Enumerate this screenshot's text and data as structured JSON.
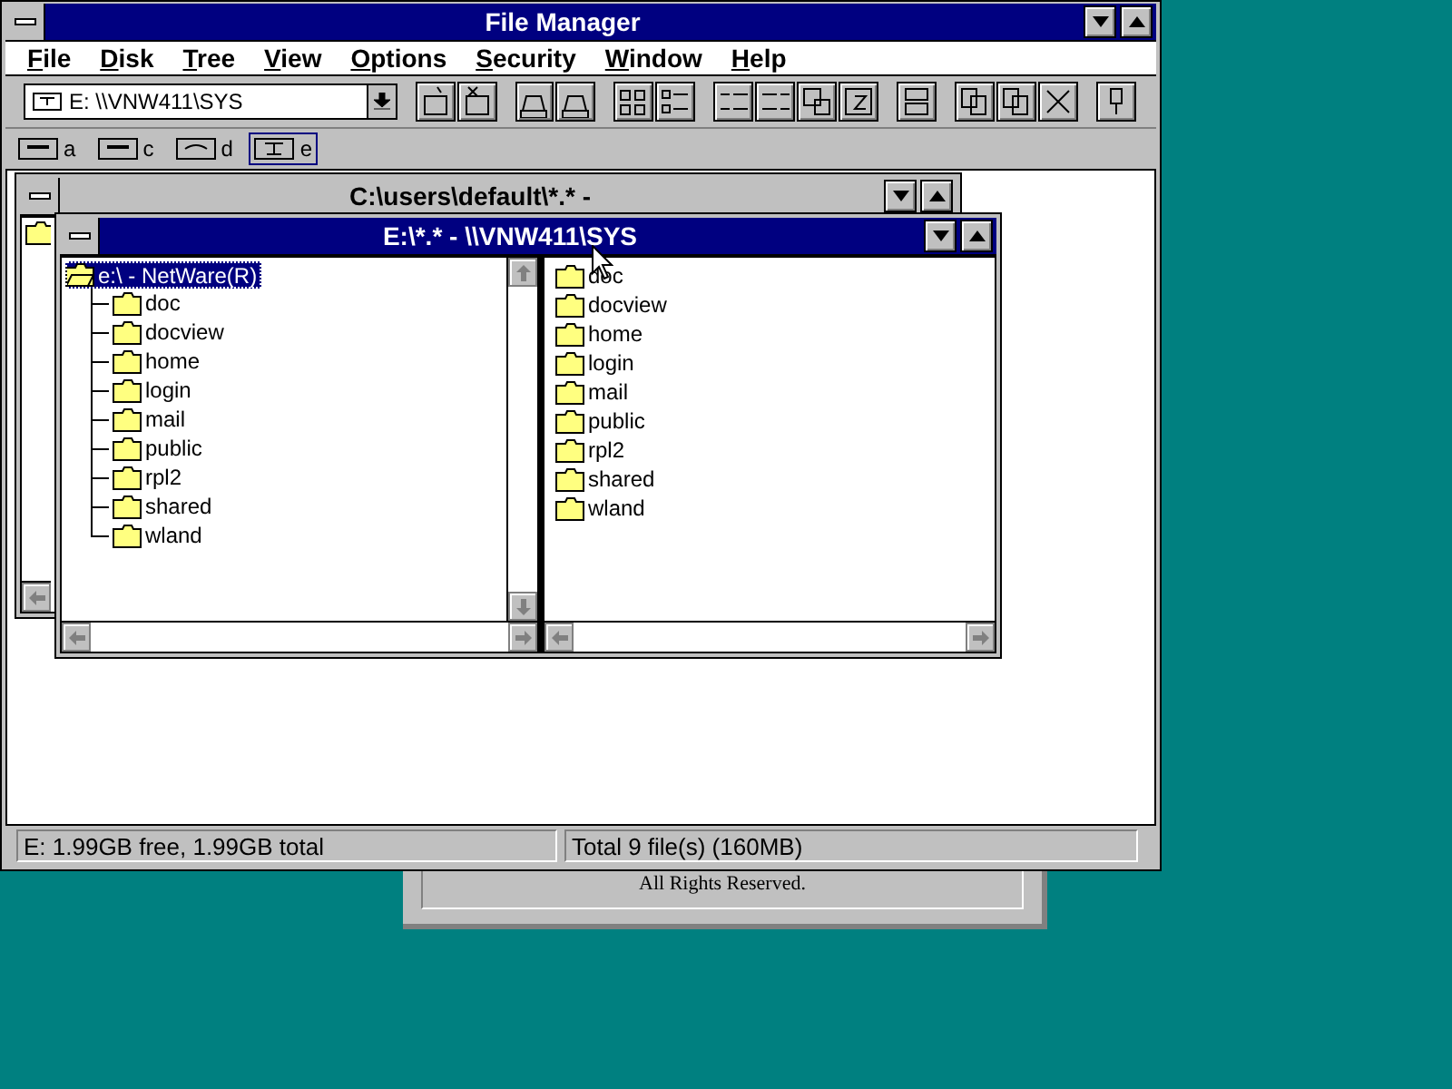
{
  "window": {
    "title": "File Manager"
  },
  "menu": [
    {
      "label": "File"
    },
    {
      "label": "Disk"
    },
    {
      "label": "Tree"
    },
    {
      "label": "View"
    },
    {
      "label": "Options"
    },
    {
      "label": "Security"
    },
    {
      "label": "Window"
    },
    {
      "label": "Help"
    }
  ],
  "drive_combo": {
    "value": "E: \\\\VNW411\\SYS"
  },
  "drives": [
    {
      "letter": "a",
      "kind": "floppy",
      "selected": false
    },
    {
      "letter": "c",
      "kind": "hard",
      "selected": false
    },
    {
      "letter": "d",
      "kind": "cdrom",
      "selected": false
    },
    {
      "letter": "e",
      "kind": "network",
      "selected": true
    }
  ],
  "back_window": {
    "title": "C:\\users\\default\\*.* -"
  },
  "active_window": {
    "title": "E:\\*.* - \\\\VNW411\\SYS",
    "tree": {
      "label": "e:\\ - NetWare(R)",
      "selected": true,
      "children": [
        {
          "label": "doc"
        },
        {
          "label": "docview"
        },
        {
          "label": "home"
        },
        {
          "label": "login"
        },
        {
          "label": "mail"
        },
        {
          "label": "public"
        },
        {
          "label": "rpl2"
        },
        {
          "label": "shared"
        },
        {
          "label": "wland"
        }
      ]
    },
    "files": [
      {
        "name": "doc"
      },
      {
        "name": "docview"
      },
      {
        "name": "home"
      },
      {
        "name": "login"
      },
      {
        "name": "mail"
      },
      {
        "name": "public"
      },
      {
        "name": "rpl2"
      },
      {
        "name": "shared"
      },
      {
        "name": "wland"
      }
    ]
  },
  "status_bar": {
    "free": "E: 1.99GB free,  1.99GB total",
    "total": "Total 9 file(s) (160MB)"
  },
  "dialog_behind": {
    "text": "All Rights Reserved."
  }
}
